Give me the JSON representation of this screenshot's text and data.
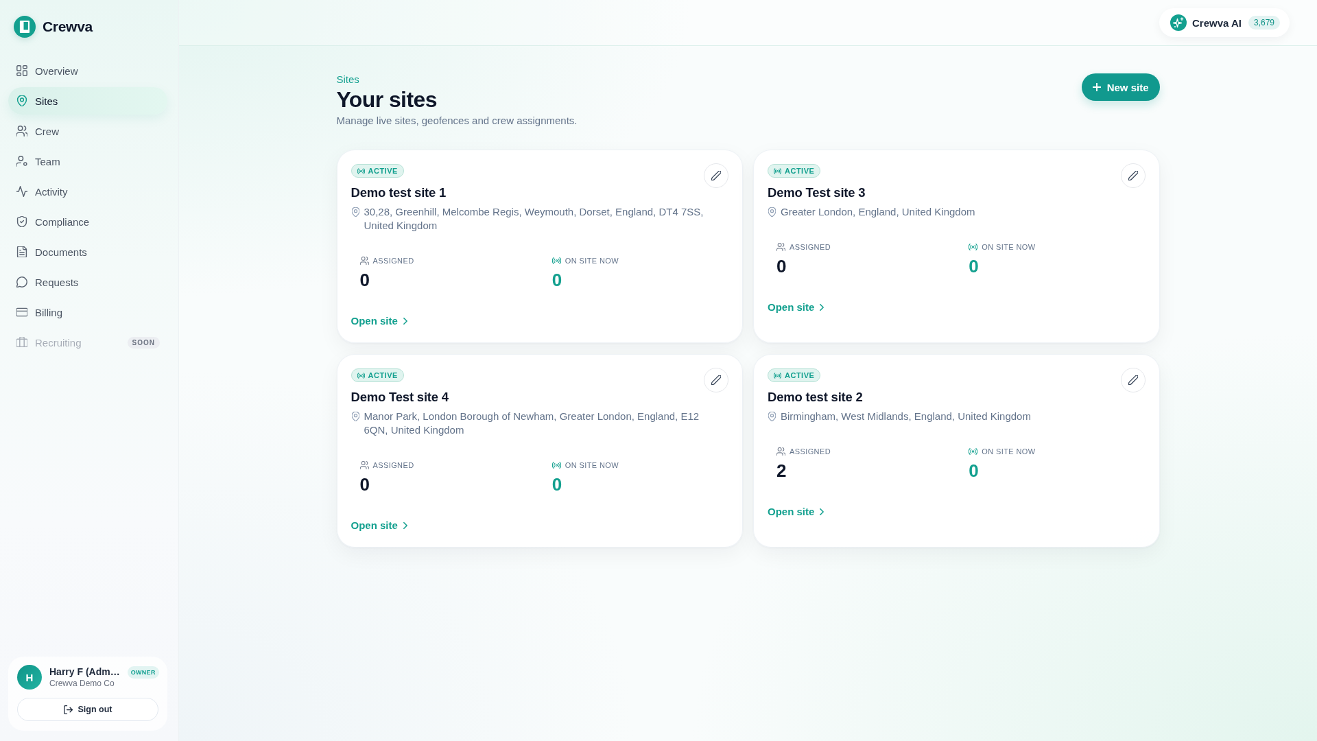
{
  "sidebar": {
    "brand": "Crewva",
    "nav": [
      {
        "label": "Overview",
        "selected": false,
        "disabled": false
      },
      {
        "label": "Sites",
        "selected": true,
        "disabled": false
      },
      {
        "label": "Crew",
        "selected": false,
        "disabled": false
      },
      {
        "label": "Team",
        "selected": false,
        "disabled": false
      },
      {
        "label": "Activity",
        "selected": false,
        "disabled": false
      },
      {
        "label": "Compliance",
        "selected": false,
        "disabled": false
      },
      {
        "label": "Documents",
        "selected": false,
        "disabled": false
      },
      {
        "label": "Requests",
        "selected": false,
        "disabled": false
      },
      {
        "label": "Billing",
        "selected": false,
        "disabled": false
      },
      {
        "label": "Recruiting",
        "selected": false,
        "disabled": true,
        "badge": "SOON"
      }
    ],
    "user": {
      "initial": "H",
      "name": "Harry F (Adm…",
      "company": "Crewva Demo Co",
      "role": "OWNER"
    },
    "sign_out": "Sign out"
  },
  "top_bar": {
    "ai_button": {
      "label": "Crewva AI",
      "count": "3,679"
    }
  },
  "header": {
    "eyebrow": "Sites",
    "title": "Your sites",
    "subtitle": "Manage live sites, geofences and crew assignments.",
    "new_button": "New site"
  },
  "sites": [
    {
      "status": "ACTIVE",
      "name": "Demo test site 1",
      "address": "30,28, Greenhill, Melcombe Regis, Weymouth, Dorset, England, DT4 7SS, United Kingdom",
      "stats": [
        {
          "kind": "assigned",
          "label": "ASSIGNED",
          "value": "0"
        },
        {
          "kind": "live",
          "label": "ON SITE NOW",
          "value": "0"
        }
      ],
      "link": "Open site"
    },
    {
      "status": "ACTIVE",
      "name": "Demo Test site 3",
      "address": "Greater London, England, United Kingdom",
      "stats": [
        {
          "kind": "assigned",
          "label": "ASSIGNED",
          "value": "0"
        },
        {
          "kind": "live",
          "label": "ON SITE NOW",
          "value": "0"
        }
      ],
      "link": "Open site"
    },
    {
      "status": "ACTIVE",
      "name": "Demo Test site 4",
      "address": "Manor Park, London Borough of Newham, Greater London, England, E12 6QN, United Kingdom",
      "stats": [
        {
          "kind": "assigned",
          "label": "ASSIGNED",
          "value": "0"
        },
        {
          "kind": "live",
          "label": "ON SITE NOW",
          "value": "0"
        }
      ],
      "link": "Open site"
    },
    {
      "status": "ACTIVE",
      "name": "Demo test site 2",
      "address": "Birmingham, West Midlands, England, United Kingdom",
      "stats": [
        {
          "kind": "assigned",
          "label": "ASSIGNED",
          "value": "2"
        },
        {
          "kind": "live",
          "label": "ON SITE NOW",
          "value": "0"
        }
      ],
      "link": "Open site"
    }
  ]
}
